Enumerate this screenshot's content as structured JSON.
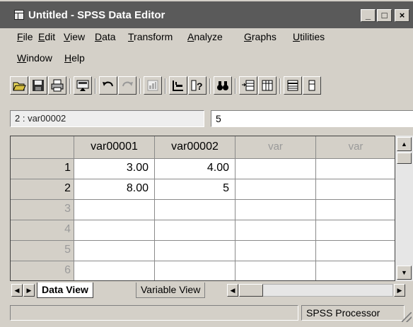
{
  "window": {
    "title": "Untitled - SPSS Data Editor",
    "controls": {
      "minimize": "_",
      "maximize": "□",
      "close": "×"
    }
  },
  "menu": {
    "items": [
      "File",
      "Edit",
      "View",
      "Data",
      "Transform",
      "Analyze",
      "Graphs",
      "Utilities",
      "Window",
      "Help"
    ]
  },
  "toolbar": {
    "buttons": [
      {
        "icon": "open-folder-icon"
      },
      {
        "icon": "save-disk-icon"
      },
      {
        "icon": "print-icon"
      },
      {
        "icon": "recall-dialog-icon"
      },
      {
        "icon": "undo-icon"
      },
      {
        "icon": "redo-icon"
      },
      {
        "icon": "goto-chart-icon"
      },
      {
        "icon": "goto-case-icon"
      },
      {
        "icon": "variables-info-icon"
      },
      {
        "icon": "find-binoculars-icon"
      },
      {
        "icon": "insert-case-icon"
      },
      {
        "icon": "insert-variable-icon"
      },
      {
        "icon": "split-file-icon"
      },
      {
        "icon": "weight-cases-icon"
      }
    ]
  },
  "cell_editor": {
    "address": "2 : var00002",
    "value": "5"
  },
  "grid": {
    "columns": [
      "var00001",
      "var00002",
      "var",
      "var"
    ],
    "rows": [
      {
        "num": "1",
        "cells": [
          "3.00",
          "4.00",
          "",
          ""
        ]
      },
      {
        "num": "2",
        "cells": [
          "8.00",
          "5",
          "",
          ""
        ]
      },
      {
        "num": "3",
        "cells": [
          "",
          "",
          "",
          ""
        ]
      },
      {
        "num": "4",
        "cells": [
          "",
          "",
          "",
          ""
        ]
      },
      {
        "num": "5",
        "cells": [
          "",
          "",
          "",
          ""
        ]
      },
      {
        "num": "6",
        "cells": [
          "",
          "",
          "",
          ""
        ]
      }
    ]
  },
  "tabs": {
    "data_view": "Data View",
    "variable_view": "Variable View",
    "active": "Data View"
  },
  "status": {
    "processor": "SPSS Processor"
  }
}
